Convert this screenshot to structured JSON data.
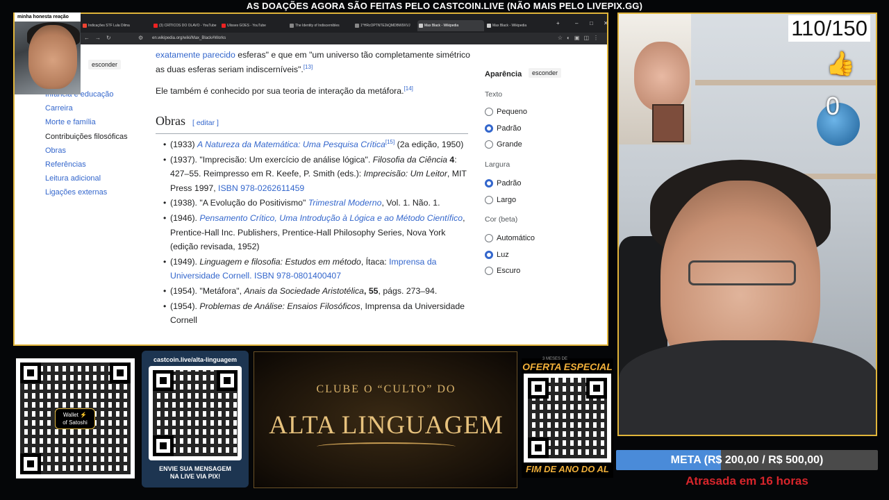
{
  "banner": "AS DOAÇÕES AGORA SÃO FEITAS PELO CASTCOIN.LIVE (NÃO MAIS PELO LIVEPIX.GG)",
  "webcam_label": "minha honesta reação",
  "browser": {
    "tabs": [
      {
        "label": "Indicações STF Lula Dilma",
        "color": "#e43"
      },
      {
        "label": "(3) CRÍTICOS DO OLAVO - YouTube",
        "color": "#e22"
      },
      {
        "label": "Ulisses GOES - YouTube",
        "color": "#e22"
      },
      {
        "label": "The Identity of Indiscernibles",
        "color": "#888"
      },
      {
        "label": "1*HRcOPTNTE2kQMDBW9XVJ",
        "color": "#888"
      },
      {
        "label": "Max Black - Wikipedia",
        "color": "#ccc",
        "active": true
      },
      {
        "label": "Max Black - Wikipedia",
        "color": "#ccc"
      }
    ],
    "url": "en.wikipedia.org/wiki/Max_Black#Works"
  },
  "toc": {
    "hide_label": "esconder",
    "items": [
      {
        "label": "Infância e educação"
      },
      {
        "label": "Carreira"
      },
      {
        "label": "Morte e família"
      },
      {
        "label": "Contribuições filosóficas",
        "current": true
      },
      {
        "label": "Obras"
      },
      {
        "label": "Referências"
      },
      {
        "label": "Leitura adicional"
      },
      {
        "label": "Ligações externas"
      }
    ]
  },
  "article": {
    "p1_link": "exatamente parecido",
    "p1_text": " esferas\" e que em \"um universo tão completamente simétrico as duas esferas seriam indiscerníveis\".",
    "p1_ref": "[13]",
    "p2_text": "Ele também é conhecido por sua teoria de interação da metáfora.",
    "p2_ref": "[14]",
    "section_title": "Obras",
    "edit_label": "[ editar ]",
    "works": {
      "w1": {
        "pre": "(1933) ",
        "link": "A Natureza da Matemática: Uma Pesquisa Crítica",
        "ref": "[15]",
        "post": " (2a edição, 1950)"
      },
      "w2": {
        "pre": "(1937). \"Imprecisão: Um exercício de análise lógica\". ",
        "italic": "Filosofia da Ciência",
        "bold": " 4",
        "mid": ": 427–55. Reimpresso em R. Keefe, P. Smith (eds.): ",
        "italic2": "Imprecisão: Um Leitor",
        "mid2": ", MIT Press 1997, ",
        "link": "ISBN 978-0262611459"
      },
      "w3": {
        "pre": "(1938). \"A Evolução do Positivismo\" ",
        "link": "Trimestral Moderno",
        "post": ", Vol. 1. Não. 1."
      },
      "w4": {
        "pre": "(1946). ",
        "link": "Pensamento Crítico, Uma Introdução à Lógica e ao Método Científico",
        "post": ", Prentice-Hall Inc. Publishers, Prentice-Hall Philosophy Series, Nova York (edição revisada, 1952)"
      },
      "w5": {
        "pre": "(1949). ",
        "italic": "Linguagem e filosofia: Estudos em método",
        "mid": ", Ítaca: ",
        "link": "Imprensa da Universidade Cornell. ISBN 978-0801400407"
      },
      "w6": {
        "pre": "(1954). \"Metáfora\", ",
        "italic": "Anais da Sociedade Aristotélica",
        "bold": ", 55",
        "post": ", págs. 273–94."
      },
      "w7": {
        "pre": "(1954). ",
        "italic": "Problemas de Análise: Ensaios Filosóficos",
        "post": ", Imprensa da Universidade Cornell"
      }
    }
  },
  "appearance": {
    "title": "Aparência",
    "hide_label": "esconder",
    "text_group": "Texto",
    "text_options": [
      {
        "label": "Pequeno"
      },
      {
        "label": "Padrão",
        "selected": true
      },
      {
        "label": "Grande"
      }
    ],
    "width_group": "Largura",
    "width_options": [
      {
        "label": "Padrão",
        "selected": true
      },
      {
        "label": "Largo"
      }
    ],
    "color_group": "Cor (beta)",
    "color_options": [
      {
        "label": "Automático"
      },
      {
        "label": "Luz",
        "selected": true
      },
      {
        "label": "Escuro"
      }
    ]
  },
  "overlay": {
    "counter": "110/150",
    "likes_count": "0",
    "wallet_label_1": "Wallet",
    "wallet_label_2": "of Satoshi",
    "castcoin_url": "castcoin.live/alta-linguagem",
    "castcoin_msg_1": "ENVIE SUA MENSAGEM",
    "castcoin_msg_2": "NA LIVE VIA PIX!",
    "club_line1": "CLUBE O “CULTO” DO",
    "club_line2": "ALTA LINGUAGEM",
    "offer_top": "OFERTA ESPECIAL",
    "offer_small": "3 MESES DE",
    "offer_bottom": "FIM DE ANO DO AL",
    "goal_text": "META (R$ 200,00 / R$ 500,00)",
    "goal_progress": 0.4,
    "late_text": "Atrasada em 16 horas"
  },
  "colors": {
    "accent": "#e1b53a",
    "wiki_link": "#3366cc",
    "goal_fill": "#4a8bd9",
    "late": "#d8252b"
  }
}
